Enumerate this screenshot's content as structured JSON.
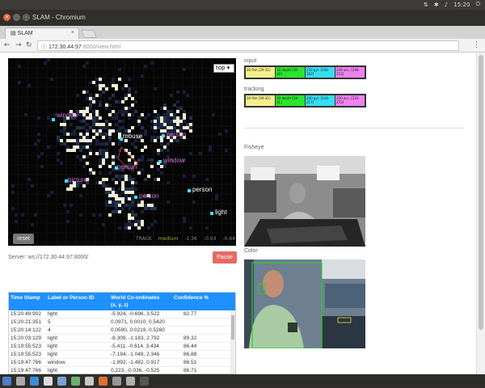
{
  "system": {
    "clock": "15:20",
    "window_title": "SLAM - Chromium"
  },
  "browser": {
    "tab_title": "SLAM",
    "url_host": "172.30.44.97",
    "url_rest": ":8000/view.html"
  },
  "map": {
    "view_select": "top",
    "reset_label": "reset",
    "labels": [
      {
        "text": "window",
        "color": "#d070d0"
      },
      {
        "text": "mouse",
        "color": "#ffffff"
      },
      {
        "text": "person",
        "color": "#d070d0"
      },
      {
        "text": "window",
        "color": "#d070d0"
      },
      {
        "text": "person",
        "color": "#d070d0"
      },
      {
        "text": "picture",
        "color": "#d070d0"
      },
      {
        "text": "person",
        "color": "#d070d0"
      },
      {
        "text": "person",
        "color": "#ffffff"
      },
      {
        "text": "light",
        "color": "#ffffff"
      }
    ],
    "track_row": {
      "name": "TRACK",
      "mode": "medium",
      "v1": "-1.36",
      "v2": "-0.03",
      "v3": "-0.64"
    }
  },
  "server": {
    "label": "Server: ws://172.30.44.97:8000/",
    "pause_label": "Pause"
  },
  "table": {
    "headers": {
      "time": "Time Stamp",
      "label": "Label or Person ID",
      "coords": "World Co-ordinates",
      "coords_sub": "(x, y, z)",
      "confidence": "Confidence %"
    },
    "rows": [
      {
        "time": "15:20:49:902",
        "label": "light",
        "coords": "-5.924, -0.696, 3.522",
        "conf": "82.77"
      },
      {
        "time": "15:20:21:351",
        "label": "5",
        "coords": "0.0971, 0.0010, 0.5420",
        "conf": ""
      },
      {
        "time": "15:20:14:122",
        "label": "4",
        "coords": "0.0590, 0.0219, 0.5260",
        "conf": ""
      },
      {
        "time": "15:20:03:129",
        "label": "light",
        "coords": "-8.309, -1.183, 2.792",
        "conf": "89.32"
      },
      {
        "time": "15:19:55:523",
        "label": "light",
        "coords": "-5.411, -0.614, 3.434",
        "conf": "86.44"
      },
      {
        "time": "15:19:55:523",
        "label": "light",
        "coords": "-7.194, -1.048, 2.346",
        "conf": "86.88"
      },
      {
        "time": "15:19:47:766",
        "label": "window",
        "coords": "-1.892, -1.482, 0.917",
        "conf": "86.51"
      },
      {
        "time": "15:19:47:766",
        "label": "light",
        "coords": "0.223, -0.036, -0.525",
        "conf": "86.71"
      }
    ]
  },
  "input": {
    "title": "input",
    "bars": [
      {
        "text": "30 fish [29-31]",
        "color": "#f6f08a"
      },
      {
        "text": "30 depth [30-30]",
        "color": "#2ae52a"
      },
      {
        "text": "250 gyr. [244-262]",
        "color": "#33dff2"
      },
      {
        "text": "249 acc. [246-253]",
        "color": "#ef82ef"
      }
    ]
  },
  "tracking": {
    "title": "tracking",
    "bars": [
      {
        "text": "30 fish [29-31]",
        "color": "#f6f08a"
      },
      {
        "text": "30 depth [28-31]",
        "color": "#2ae52a"
      },
      {
        "text": "200 gyr. [144-217]",
        "color": "#33dff2"
      },
      {
        "text": "200 acc. [231-272]",
        "color": "#ef82ef"
      }
    ]
  },
  "fisheye": {
    "title": "Fisheye"
  },
  "color": {
    "title": "Color"
  }
}
